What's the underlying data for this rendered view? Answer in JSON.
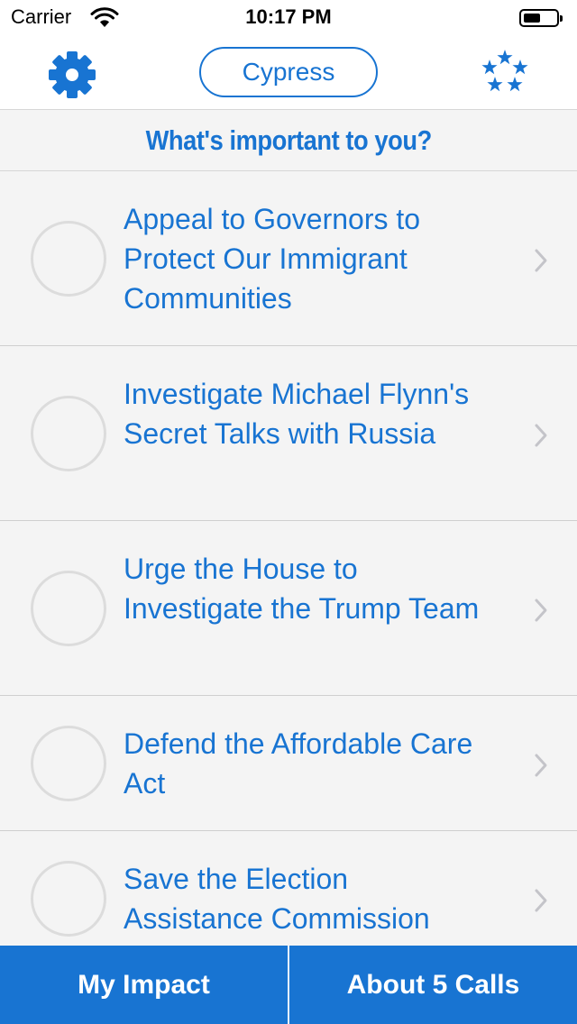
{
  "status_bar": {
    "carrier": "Carrier",
    "time": "10:17 PM"
  },
  "nav": {
    "location_label": "Cypress",
    "settings_icon": "gear-icon",
    "stars_icon": "stars-icon"
  },
  "header": {
    "title": "What's important to you?"
  },
  "issues": [
    {
      "title": "Appeal to Governors to Protect Our Immigrant Communities",
      "completed": false
    },
    {
      "title": "Investigate Michael Flynn's Secret Talks with Russia",
      "completed": false
    },
    {
      "title": "Urge the House to Investigate the Trump Team",
      "completed": false
    },
    {
      "title": "Defend the Affordable Care Act",
      "completed": false
    },
    {
      "title": "Save the Election Assistance Commission",
      "completed": false
    }
  ],
  "tabs": {
    "impact_label": "My Impact",
    "about_label": "About 5 Calls"
  },
  "colors": {
    "accent": "#1874d2",
    "background": "#f4f4f4"
  }
}
